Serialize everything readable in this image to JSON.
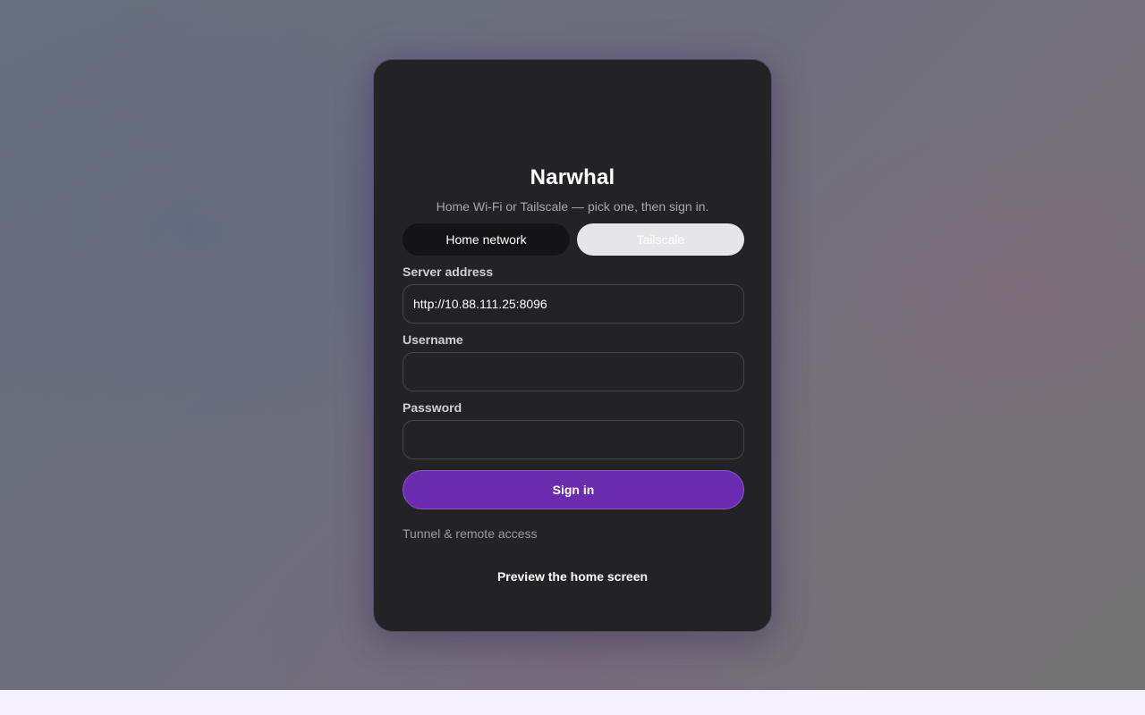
{
  "app": {
    "title": "Narwhal",
    "subtitle": "Home Wi-Fi or Tailscale — pick one, then sign in."
  },
  "mode_toggle": {
    "options": [
      {
        "label": "Home network",
        "selected": true
      },
      {
        "label": "Tailscale",
        "selected": false
      }
    ]
  },
  "form": {
    "server": {
      "label": "Server address",
      "value": "http://10.88.111.25:8096"
    },
    "username": {
      "label": "Username",
      "value": ""
    },
    "password": {
      "label": "Password",
      "value": ""
    },
    "submit_label": "Sign in"
  },
  "links": {
    "tunnel": "Tunnel & remote access",
    "preview": "Preview the home screen"
  },
  "colors": {
    "accent": "#6a2bb0",
    "card": "#232326"
  }
}
